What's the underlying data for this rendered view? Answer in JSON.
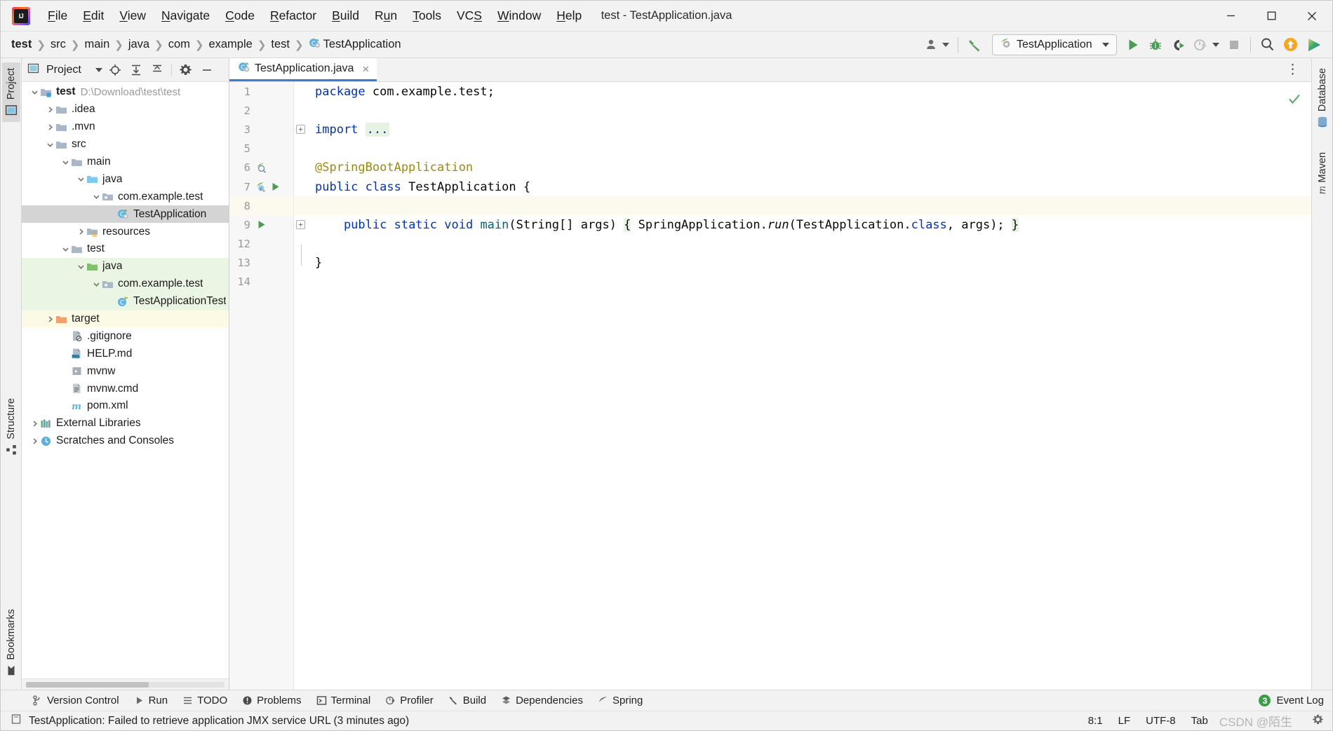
{
  "window": {
    "title": "test - TestApplication.java",
    "app_logo": "intellij-idea-logo",
    "controls": {
      "minimize": "minimize",
      "maximize": "maximize",
      "close": "close"
    }
  },
  "menubar": [
    {
      "label": "File",
      "mnemonic": "F"
    },
    {
      "label": "Edit",
      "mnemonic": "E"
    },
    {
      "label": "View",
      "mnemonic": "V"
    },
    {
      "label": "Navigate",
      "mnemonic": "N"
    },
    {
      "label": "Code",
      "mnemonic": "C"
    },
    {
      "label": "Refactor",
      "mnemonic": "R"
    },
    {
      "label": "Build",
      "mnemonic": "B"
    },
    {
      "label": "Run",
      "mnemonic": "u"
    },
    {
      "label": "Tools",
      "mnemonic": "T"
    },
    {
      "label": "VCS",
      "mnemonic": "S"
    },
    {
      "label": "Window",
      "mnemonic": "W"
    },
    {
      "label": "Help",
      "mnemonic": "H"
    }
  ],
  "navbar": {
    "breadcrumbs": [
      "test",
      "src",
      "main",
      "java",
      "com",
      "example",
      "test",
      "TestApplication"
    ],
    "run_config": "TestApplication",
    "buttons": {
      "profile": "user-profile",
      "build": "build-hammer",
      "run": "run",
      "debug": "debug",
      "run_with_coverage": "run-with-coverage",
      "profiler": "profiler",
      "stop": "stop",
      "search": "search-everywhere",
      "updates": "updates",
      "ide_feature": "ide-feature"
    }
  },
  "left_rail": {
    "top": [
      "Project",
      "Structure"
    ],
    "bottom": [
      "Bookmarks"
    ]
  },
  "right_rail": {
    "items": [
      "Database",
      "Maven"
    ]
  },
  "project_panel": {
    "title": "Project",
    "header_buttons": [
      "chevron-down",
      "locate",
      "expand-all",
      "collapse-all",
      "settings",
      "hide"
    ],
    "tree": [
      {
        "label": "test",
        "path": "D:\\Download\\test\\test",
        "indent": 0,
        "arrow": "down",
        "icon": "module-folder",
        "bold": true,
        "state": "normal"
      },
      {
        "label": ".idea",
        "path": "",
        "indent": 1,
        "arrow": "right",
        "icon": "folder-gray",
        "bold": false,
        "state": "normal"
      },
      {
        "label": ".mvn",
        "path": "",
        "indent": 1,
        "arrow": "right",
        "icon": "folder-gray",
        "bold": false,
        "state": "normal"
      },
      {
        "label": "src",
        "path": "",
        "indent": 1,
        "arrow": "down",
        "icon": "folder-gray",
        "bold": false,
        "state": "normal"
      },
      {
        "label": "main",
        "path": "",
        "indent": 2,
        "arrow": "down",
        "icon": "folder-gray",
        "bold": false,
        "state": "normal"
      },
      {
        "label": "java",
        "path": "",
        "indent": 3,
        "arrow": "down",
        "icon": "folder-blue",
        "bold": false,
        "state": "normal"
      },
      {
        "label": "com.example.test",
        "path": "",
        "indent": 4,
        "arrow": "down",
        "icon": "package",
        "bold": false,
        "state": "normal"
      },
      {
        "label": "TestApplication",
        "path": "",
        "indent": 5,
        "arrow": "none",
        "icon": "class-runnable",
        "bold": false,
        "state": "selected"
      },
      {
        "label": "resources",
        "path": "",
        "indent": 3,
        "arrow": "right",
        "icon": "folder-resources",
        "bold": false,
        "state": "normal"
      },
      {
        "label": "test",
        "path": "",
        "indent": 2,
        "arrow": "down",
        "icon": "folder-gray",
        "bold": false,
        "state": "normal"
      },
      {
        "label": "java",
        "path": "",
        "indent": 3,
        "arrow": "down",
        "icon": "folder-green",
        "bold": false,
        "state": "green"
      },
      {
        "label": "com.example.test",
        "path": "",
        "indent": 4,
        "arrow": "down",
        "icon": "package",
        "bold": false,
        "state": "green"
      },
      {
        "label": "TestApplicationTests",
        "path": "",
        "indent": 5,
        "arrow": "none",
        "icon": "class-test",
        "bold": false,
        "state": "green"
      },
      {
        "label": "target",
        "path": "",
        "indent": 1,
        "arrow": "right",
        "icon": "folder-orange",
        "bold": false,
        "state": "yellow"
      },
      {
        "label": ".gitignore",
        "path": "",
        "indent": 2,
        "arrow": "none",
        "icon": "file-ignored",
        "bold": false,
        "state": "normal"
      },
      {
        "label": "HELP.md",
        "path": "",
        "indent": 2,
        "arrow": "none",
        "icon": "file-markdown",
        "bold": false,
        "state": "normal"
      },
      {
        "label": "mvnw",
        "path": "",
        "indent": 2,
        "arrow": "none",
        "icon": "file-script",
        "bold": false,
        "state": "normal"
      },
      {
        "label": "mvnw.cmd",
        "path": "",
        "indent": 2,
        "arrow": "none",
        "icon": "file-text",
        "bold": false,
        "state": "normal"
      },
      {
        "label": "pom.xml",
        "path": "",
        "indent": 2,
        "arrow": "none",
        "icon": "file-maven",
        "bold": false,
        "state": "normal"
      },
      {
        "label": "External Libraries",
        "path": "",
        "indent": 0,
        "arrow": "right",
        "icon": "libraries",
        "bold": false,
        "state": "normal"
      },
      {
        "label": "Scratches and Consoles",
        "path": "",
        "indent": 0,
        "arrow": "right",
        "icon": "scratches",
        "bold": false,
        "state": "normal"
      }
    ]
  },
  "editor": {
    "tab": {
      "label": "TestApplication.java",
      "icon": "spring-class-icon",
      "close": "×"
    },
    "more_actions": "⋮",
    "inspection_status": "ok-check",
    "line_numbers": [
      "1",
      "2",
      "3",
      "5",
      "6",
      "7",
      "8",
      "9",
      "12",
      "13",
      "14"
    ],
    "lines": [
      {
        "num": "1",
        "indent": 0,
        "gutter_icons": [],
        "tokens": [
          {
            "t": "package ",
            "c": "kw"
          },
          {
            "t": "com.example.test;",
            "c": "plain"
          }
        ]
      },
      {
        "num": "2",
        "indent": 0,
        "gutter_icons": [],
        "tokens": []
      },
      {
        "num": "3",
        "indent": 0,
        "fold": "expand",
        "gutter_icons": [],
        "tokens": [
          {
            "t": "import ",
            "c": "kw"
          },
          {
            "t": "...",
            "c": "fold"
          }
        ]
      },
      {
        "num": "5",
        "indent": 0,
        "gutter_icons": [],
        "tokens": []
      },
      {
        "num": "6",
        "indent": 0,
        "gutter_icons": [
          "spring-bean"
        ],
        "tokens": [
          {
            "t": "@SpringBootApplication",
            "c": "ann"
          }
        ]
      },
      {
        "num": "7",
        "indent": 0,
        "gutter_icons": [
          "spring-bean-2",
          "run-gutter"
        ],
        "tokens": [
          {
            "t": "public ",
            "c": "kw"
          },
          {
            "t": "class ",
            "c": "kw"
          },
          {
            "t": "TestApplication {",
            "c": "plain"
          }
        ]
      },
      {
        "num": "8",
        "indent": 0,
        "caret": true,
        "gutter_icons": [],
        "tokens": []
      },
      {
        "num": "9",
        "indent": 1,
        "fold": "collapse",
        "gutter_icons": [
          "run-gutter"
        ],
        "tokens": [
          {
            "t": "    public ",
            "c": "kw"
          },
          {
            "t": "static ",
            "c": "kw"
          },
          {
            "t": "void ",
            "c": "kw"
          },
          {
            "t": "main",
            "c": "mth"
          },
          {
            "t": "(String[] args) ",
            "c": "plain"
          },
          {
            "t": "{",
            "c": "brace"
          },
          {
            "t": " SpringApplication.",
            "c": "plain"
          },
          {
            "t": "run",
            "c": "italic"
          },
          {
            "t": "(TestApplication.",
            "c": "plain"
          },
          {
            "t": "class",
            "c": "kw"
          },
          {
            "t": ", args); ",
            "c": "plain"
          },
          {
            "t": "}",
            "c": "brace"
          }
        ]
      },
      {
        "num": "12",
        "indent": 0,
        "gutter_icons": [],
        "tokens": []
      },
      {
        "num": "13",
        "indent": 0,
        "gutter_icons": [],
        "tokens": [
          {
            "t": "}",
            "c": "plain"
          }
        ]
      },
      {
        "num": "14",
        "indent": 0,
        "gutter_icons": [],
        "tokens": []
      }
    ]
  },
  "tool_windows": [
    {
      "label": "Version Control",
      "icon": "branch-icon"
    },
    {
      "label": "Run",
      "icon": "run-icon"
    },
    {
      "label": "TODO",
      "icon": "todo-icon"
    },
    {
      "label": "Problems",
      "icon": "problems-icon"
    },
    {
      "label": "Terminal",
      "icon": "terminal-icon"
    },
    {
      "label": "Profiler",
      "icon": "profiler-icon"
    },
    {
      "label": "Build",
      "icon": "build-icon"
    },
    {
      "label": "Dependencies",
      "icon": "dependencies-icon"
    },
    {
      "label": "Spring",
      "icon": "spring-icon"
    }
  ],
  "event_log": {
    "label": "Event Log",
    "count": "3"
  },
  "statusbar": {
    "message": "TestApplication: Failed to retrieve application JMX service URL (3 minutes ago)",
    "caret_position": "8:1",
    "line_separator": "LF",
    "encoding": "UTF-8",
    "indent": "Tab",
    "watermark": "CSDN @陌生"
  }
}
